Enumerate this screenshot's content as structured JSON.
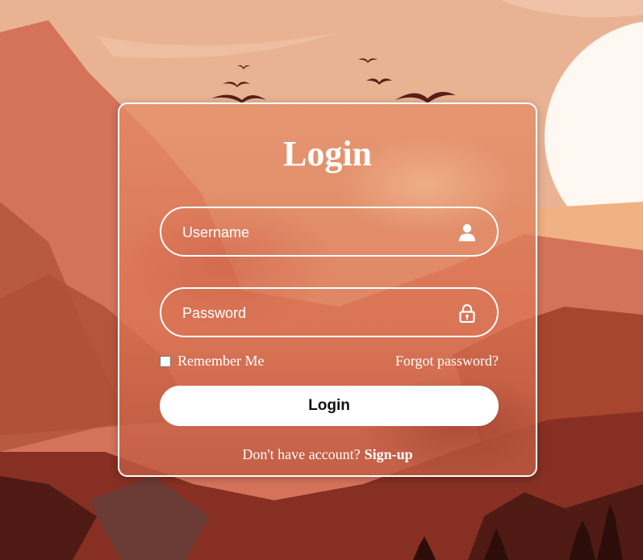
{
  "login": {
    "title": "Login",
    "username_placeholder": "Username",
    "password_placeholder": "Password",
    "remember_label": "Remember Me",
    "forgot_label": "Forgot password?",
    "button_label": "Login",
    "signup_prompt": "Don't have account?",
    "signup_label": "Sign-up"
  },
  "colors": {
    "sky": "#e9b393",
    "sun": "#fff7f2",
    "mountain_light": "#d4735a",
    "mountain_mid": "#b85a3f",
    "mountain_dark": "#872f22",
    "mountain_darkest": "#4f1a14",
    "button_bg": "#ffffff",
    "text": "#ffffff"
  },
  "icons": {
    "username": "user-icon",
    "password": "lock-icon"
  }
}
